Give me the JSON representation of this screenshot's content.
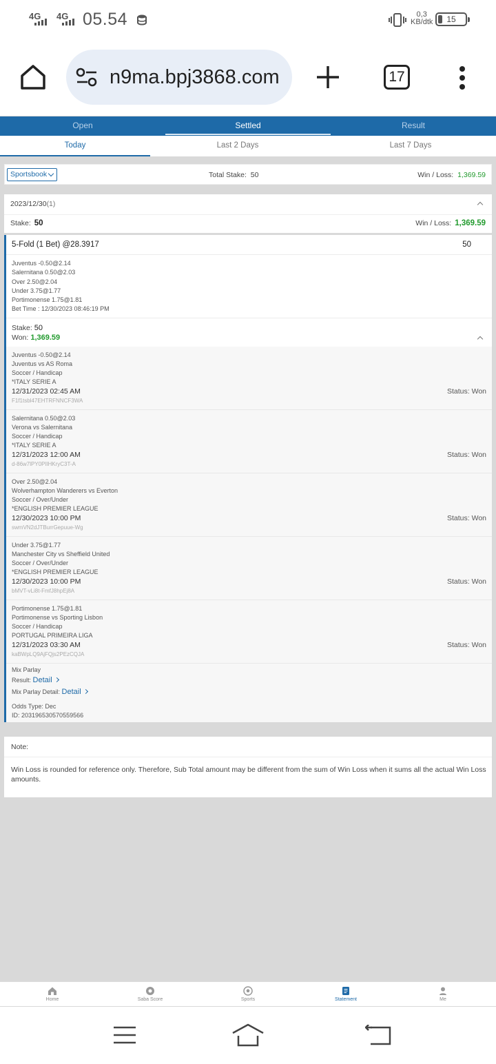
{
  "status_bar": {
    "network_1": "4G",
    "network_2": "4G",
    "time": "05.54",
    "data_rate_value": "0,3",
    "data_rate_unit": "KB/dtk",
    "battery_level": 15,
    "battery_text": "15"
  },
  "browser": {
    "url": "n9ma.bpj3868.com",
    "tab_count": "17"
  },
  "top_tabs": [
    "Open",
    "Settled",
    "Result"
  ],
  "top_tabs_active": "Settled",
  "sub_tabs": [
    "Today",
    "Last 2 Days",
    "Last 7 Days"
  ],
  "sub_tabs_active": "Today",
  "filter": {
    "select_value": "Sportsbook",
    "total_stake_label": "Total Stake:",
    "total_stake_value": "50",
    "win_loss_label": "Win / Loss:",
    "win_loss_value": "1,369.59"
  },
  "date_group": {
    "date": "2023/12/30",
    "count": "(1)",
    "stake_label": "Stake:",
    "stake_value": "50",
    "win_loss_label": "Win / Loss:",
    "win_loss_value": "1,369.59"
  },
  "bet": {
    "title": "5-Fold (1 Bet) @28.3917",
    "amount": "50",
    "legs_summary": [
      "Juventus -0.50@2.14",
      "Salernitana 0.50@2.03",
      "Over 2.50@2.04",
      "Under 3.75@1.77",
      "Portimonense 1.75@1.81"
    ],
    "bet_time": "Bet Time : 12/30/2023 08:46:19 PM",
    "stake_label": "Stake:",
    "stake_value": "50",
    "won_label": "Won:",
    "won_value": "1,369.59",
    "details": [
      {
        "selection": "Juventus -0.50@2.14",
        "match": "Juventus vs AS Roma",
        "market": "Soccer / Handicap",
        "league": "*ITALY SERIE A",
        "datetime": "12/31/2023 02:45 AM",
        "ref": "F1f1tsbl47EHTRFNNCF3WA",
        "status_label": "Status:",
        "status": "Won"
      },
      {
        "selection": "Salernitana 0.50@2.03",
        "match": "Verona vs Salernitana",
        "market": "Soccer / Handicap",
        "league": "*ITALY SERIE A",
        "datetime": "12/31/2023 12:00 AM",
        "ref": "d-86w7lPY0PlIHKryC3T-A",
        "status_label": "Status:",
        "status": "Won"
      },
      {
        "selection": "Over 2.50@2.04",
        "match": "Wolverhampton Wanderers vs Everton",
        "market": "Soccer / Over/Under",
        "league": "*ENGLISH PREMIER LEAGUE",
        "datetime": "12/30/2023 10:00 PM",
        "ref": "swmVN2dJTBurrGepuue-Wg",
        "status_label": "Status:",
        "status": "Won"
      },
      {
        "selection": "Under 3.75@1.77",
        "match": "Manchester City vs Sheffield United",
        "market": "Soccer / Over/Under",
        "league": "*ENGLISH PREMIER LEAGUE",
        "datetime": "12/30/2023 10:00 PM",
        "ref": "bMVT-vLi8t-FmfJ8hpEj8A",
        "status_label": "Status:",
        "status": "Won"
      },
      {
        "selection": "Portimonense 1.75@1.81",
        "match": "Portimonense vs Sporting Lisbon",
        "market": "Soccer / Handicap",
        "league": "PORTUGAL PRIMEIRA LIGA",
        "datetime": "12/31/2023 03:30 AM",
        "ref": "kaBWpLQ9AjFQjs2PEzCQJA",
        "status_label": "Status:",
        "status": "Won"
      }
    ],
    "mix_parlay": "Mix Parlay",
    "result_label": "Result:",
    "result_link": "Detail",
    "mix_detail_label": "Mix Parlay Detail:",
    "mix_detail_link": "Detail",
    "odds_type": "Odds Type: Dec",
    "bet_id": "ID: 203196530570559566"
  },
  "note": {
    "title": "Note:",
    "text": "Win Loss is rounded for reference only. Therefore, Sub Total amount may be different from the sum of Win Loss when it sums all the actual Win Loss amounts."
  },
  "bottom_nav": [
    "Home",
    "Saba Score",
    "Sports",
    "Statement",
    "Me"
  ],
  "bottom_nav_active": "Statement",
  "colors": {
    "primary": "#1e6aa8",
    "win_green": "#219a2d",
    "background": "#d9d9d9"
  }
}
